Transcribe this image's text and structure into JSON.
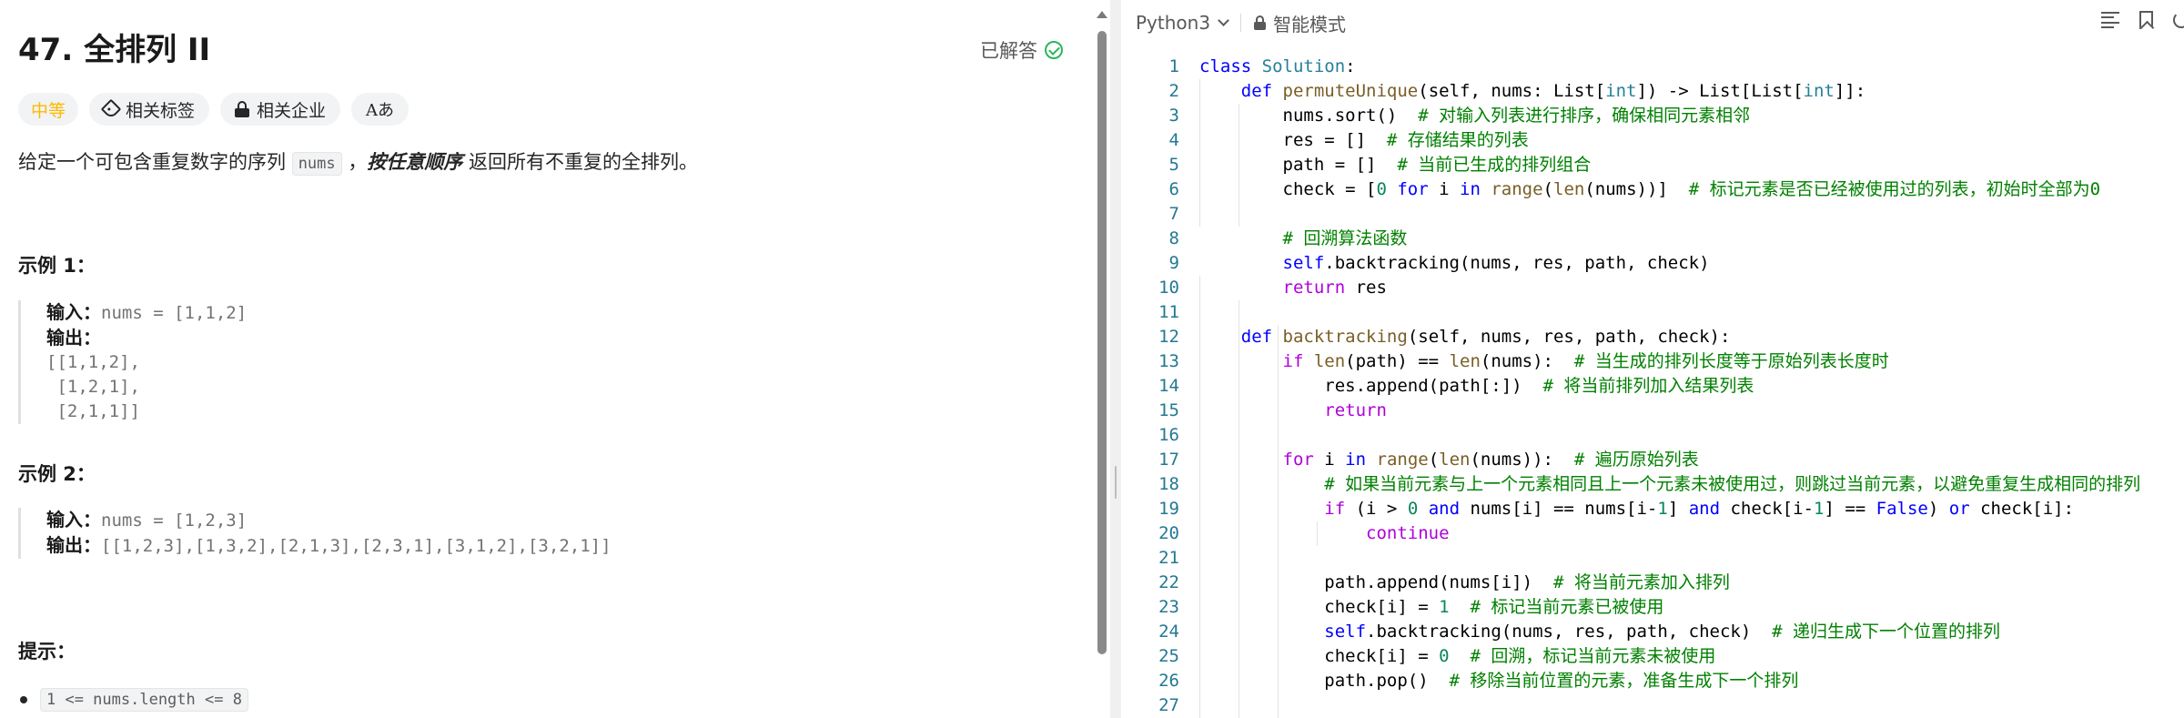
{
  "problem": {
    "title": "47. 全排列 II",
    "solved_label": "已解答",
    "tags": {
      "difficulty": "中等",
      "related_tags": "相关标签",
      "related_companies": "相关企业",
      "translate": "Aあ"
    },
    "description": {
      "part1": "给定一个可包含重复数字的序列 ",
      "code": "nums",
      "part2": " ，",
      "emphasis": "按任意顺序",
      "part3": " 返回所有不重复的全排列。"
    },
    "examples": [
      {
        "title": "示例 1：",
        "input_label": "输入：",
        "input_value": "nums = [1,1,2]",
        "output_label": "输出：",
        "output_lines": [
          "[[1,1,2],",
          " [1,2,1],",
          " [2,1,1]]"
        ]
      },
      {
        "title": "示例 2：",
        "input_label": "输入：",
        "input_value": "nums = [1,2,3]",
        "output_label": "输出：",
        "output_value": "[[1,2,3],[1,3,2],[2,1,3],[2,3,1],[3,1,2],[3,2,1]]"
      }
    ],
    "hints_title": "提示：",
    "hint_first": "1 <= nums.length <= 8"
  },
  "editor": {
    "language": "Python3",
    "mode": "智能模式"
  },
  "code_lines": [
    {
      "n": "1",
      "t": [
        [
          "kw",
          "class "
        ],
        [
          "cls",
          "Solution"
        ],
        [
          "",
          ":"
        ]
      ]
    },
    {
      "n": "2",
      "t": [
        [
          "",
          "    "
        ],
        [
          "kw",
          "def "
        ],
        [
          "fn",
          "permuteUnique"
        ],
        [
          "",
          "(self, nums: List["
        ],
        [
          "cls",
          "int"
        ],
        [
          "",
          "]) -> List[List["
        ],
        [
          "cls",
          "int"
        ],
        [
          "",
          "]]:"
        ]
      ]
    },
    {
      "n": "3",
      "t": [
        [
          "",
          "        nums.sort()  "
        ],
        [
          "cm",
          "# 对输入列表进行排序，确保相同元素相邻"
        ]
      ]
    },
    {
      "n": "4",
      "t": [
        [
          "",
          "        res = []  "
        ],
        [
          "cm",
          "# 存储结果的列表"
        ]
      ]
    },
    {
      "n": "5",
      "t": [
        [
          "",
          "        path = []  "
        ],
        [
          "cm",
          "# 当前已生成的排列组合"
        ]
      ]
    },
    {
      "n": "6",
      "t": [
        [
          "",
          "        check = ["
        ],
        [
          "num",
          "0"
        ],
        [
          "kw",
          " for "
        ],
        [
          "",
          "i "
        ],
        [
          "kw",
          "in "
        ],
        [
          "fn",
          "range"
        ],
        [
          "",
          "("
        ],
        [
          "fn",
          "len"
        ],
        [
          "",
          "(nums))]  "
        ],
        [
          "cm",
          "# 标记元素是否已经被使用过的列表，初始时全部为0"
        ]
      ]
    },
    {
      "n": "7",
      "t": [
        [
          "",
          ""
        ]
      ]
    },
    {
      "n": "8",
      "t": [
        [
          "",
          "        "
        ],
        [
          "cm",
          "# 回溯算法函数"
        ]
      ]
    },
    {
      "n": "9",
      "t": [
        [
          "",
          "        "
        ],
        [
          "sf",
          "self"
        ],
        [
          "",
          ".backtracking(nums, res, path, check)"
        ]
      ]
    },
    {
      "n": "10",
      "t": [
        [
          "",
          "        "
        ],
        [
          "ctl",
          "return "
        ],
        [
          "",
          "res"
        ]
      ]
    },
    {
      "n": "11",
      "t": [
        [
          "",
          ""
        ]
      ]
    },
    {
      "n": "12",
      "t": [
        [
          "",
          "    "
        ],
        [
          "kw",
          "def "
        ],
        [
          "fn",
          "backtracking"
        ],
        [
          "",
          "(self, nums, res, path, check):"
        ]
      ]
    },
    {
      "n": "13",
      "t": [
        [
          "",
          "        "
        ],
        [
          "ctl",
          "if "
        ],
        [
          "fn",
          "len"
        ],
        [
          "",
          "(path) == "
        ],
        [
          "fn",
          "len"
        ],
        [
          "",
          "(nums):  "
        ],
        [
          "cm",
          "# 当生成的排列长度等于原始列表长度时"
        ]
      ]
    },
    {
      "n": "14",
      "t": [
        [
          "",
          "            res.append(path[:])  "
        ],
        [
          "cm",
          "# 将当前排列加入结果列表"
        ]
      ]
    },
    {
      "n": "15",
      "t": [
        [
          "",
          "            "
        ],
        [
          "ctl",
          "return"
        ]
      ]
    },
    {
      "n": "16",
      "t": [
        [
          "",
          ""
        ]
      ]
    },
    {
      "n": "17",
      "t": [
        [
          "",
          "        "
        ],
        [
          "ctl",
          "for "
        ],
        [
          "",
          "i "
        ],
        [
          "kw",
          "in "
        ],
        [
          "fn",
          "range"
        ],
        [
          "",
          "("
        ],
        [
          "fn",
          "len"
        ],
        [
          "",
          "(nums)):  "
        ],
        [
          "cm",
          "# 遍历原始列表"
        ]
      ]
    },
    {
      "n": "18",
      "t": [
        [
          "",
          "            "
        ],
        [
          "cm",
          "# 如果当前元素与上一个元素相同且上一个元素未被使用过，则跳过当前元素，以避免重复生成相同的排列"
        ]
      ]
    },
    {
      "n": "19",
      "t": [
        [
          "",
          "            "
        ],
        [
          "ctl",
          "if "
        ],
        [
          "",
          "(i > "
        ],
        [
          "num",
          "0"
        ],
        [
          "kw",
          " and "
        ],
        [
          "",
          "nums[i] == nums[i-"
        ],
        [
          "num",
          "1"
        ],
        [
          "",
          "] "
        ],
        [
          "kw",
          "and "
        ],
        [
          "",
          "check[i-"
        ],
        [
          "num",
          "1"
        ],
        [
          "",
          "] == "
        ],
        [
          "kw",
          "False"
        ],
        [
          "",
          ") "
        ],
        [
          "kw",
          "or "
        ],
        [
          "",
          "check[i]:"
        ]
      ]
    },
    {
      "n": "20",
      "t": [
        [
          "",
          "                "
        ],
        [
          "ctl",
          "continue"
        ]
      ]
    },
    {
      "n": "21",
      "t": [
        [
          "",
          ""
        ]
      ]
    },
    {
      "n": "22",
      "t": [
        [
          "",
          "            path.append(nums[i])  "
        ],
        [
          "cm",
          "# 将当前元素加入排列"
        ]
      ]
    },
    {
      "n": "23",
      "t": [
        [
          "",
          "            check[i] = "
        ],
        [
          "num",
          "1"
        ],
        [
          "",
          "  "
        ],
        [
          "cm",
          "# 标记当前元素已被使用"
        ]
      ]
    },
    {
      "n": "24",
      "t": [
        [
          "",
          "            "
        ],
        [
          "sf",
          "self"
        ],
        [
          "",
          ".backtracking(nums, res, path, check)  "
        ],
        [
          "cm",
          "# 递归生成下一个位置的排列"
        ]
      ]
    },
    {
      "n": "25",
      "t": [
        [
          "",
          "            check[i] = "
        ],
        [
          "num",
          "0"
        ],
        [
          "",
          "  "
        ],
        [
          "cm",
          "# 回溯，标记当前元素未被使用"
        ]
      ]
    },
    {
      "n": "26",
      "t": [
        [
          "",
          "            path.pop()  "
        ],
        [
          "cm",
          "# 移除当前位置的元素，准备生成下一个排列"
        ]
      ]
    },
    {
      "n": "27",
      "t": [
        [
          "",
          ""
        ]
      ]
    }
  ]
}
